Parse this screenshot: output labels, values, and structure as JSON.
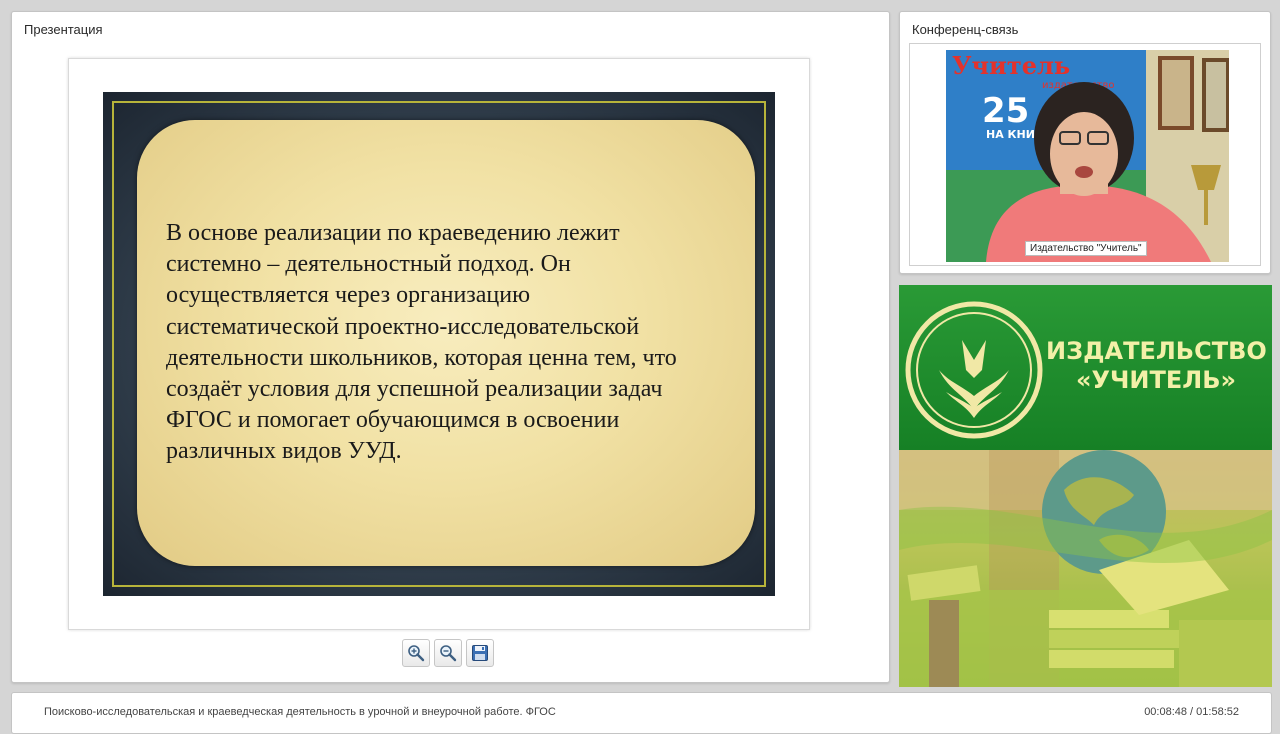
{
  "presentation": {
    "title": "Презентация",
    "slide_text": "В основе реализации по краеведению лежит\nсистемно – деятельностный подход. Он\nосуществляется через организацию\nсистематической проектно-исследовательской\nдеятельности школьников, которая ценна тем, что\nсоздаёт условия для успешной реализации задач\nФГОС и помогает обучающимся в освоении\nразличных видов УУД.",
    "toolbar": [
      {
        "name": "zoom-in-icon"
      },
      {
        "name": "zoom-out-icon"
      },
      {
        "name": "save-icon"
      }
    ]
  },
  "conference": {
    "title": "Конференц-связь",
    "speaker_caption": "Издательство \"Учитель\"",
    "backdrop_text": "Учитель",
    "backdrop_sub": "издательство",
    "backdrop_number": "25",
    "backdrop_caption": "НА КНИЖ"
  },
  "banner": {
    "brand_name": "ИЗДАТЕЛЬСТВО\n«УЧИТЕЛЬ»"
  },
  "footer": {
    "title": "Поисково-исследовательская и краеведческая деятельность в урочной и внеурочной работе. ФГОС",
    "time": "00:08:48 / 01:58:52"
  },
  "colors": {
    "brand_green": "#1f8a2c",
    "brand_text": "#f3f0a8",
    "slide_card": "#f1e1a4",
    "slide_border": "#b7b43a"
  }
}
